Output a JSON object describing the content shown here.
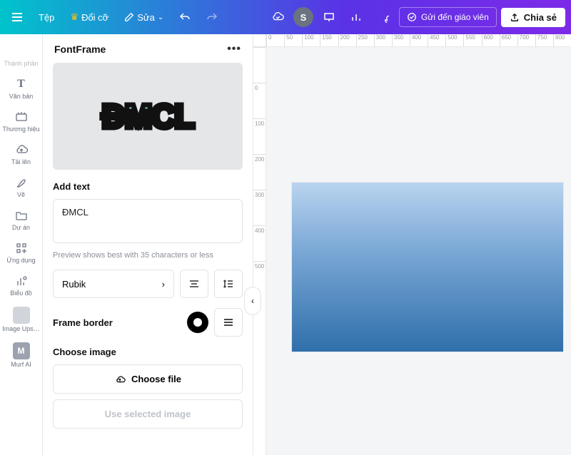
{
  "topbar": {
    "file_label": "Tệp",
    "resize_label": "Đổi cỡ",
    "edit_label": "Sửa",
    "avatar_initial": "S",
    "send_teacher_label": "Gửi đến giáo viên",
    "share_label": "Chia sẻ"
  },
  "leftnav": {
    "items": [
      {
        "label": "Thành phần",
        "icon": ""
      },
      {
        "label": "Văn bản",
        "icon": "T"
      },
      {
        "label": "Thương hiệu",
        "icon": "⎘"
      },
      {
        "label": "Tải lên",
        "icon": "☁"
      },
      {
        "label": "Vẽ",
        "icon": "✎"
      },
      {
        "label": "Dự án",
        "icon": "▭"
      },
      {
        "label": "Ứng dụng",
        "icon": "⊞"
      },
      {
        "label": "Biểu đồ",
        "icon": "⫞"
      },
      {
        "label": "Image Ups…",
        "icon": ""
      },
      {
        "label": "Murf AI",
        "icon": "M"
      }
    ]
  },
  "panel": {
    "title": "FontFrame",
    "preview_text": "ĐMCL",
    "add_text_label": "Add text",
    "text_value": "ĐMCL",
    "hint": "Preview shows best with 35 characters or less",
    "font_name": "Rubik",
    "frame_border_label": "Frame border",
    "choose_image_label": "Choose image",
    "choose_file_label": "Choose file",
    "use_selected_label": "Use selected image"
  },
  "ruler": {
    "h_ticks": [
      "0",
      "50",
      "100",
      "150",
      "200",
      "250",
      "300",
      "350",
      "400",
      "450",
      "500",
      "550",
      "600",
      "650",
      "700",
      "750",
      "800"
    ],
    "v_ticks": [
      "",
      "0",
      "100",
      "200",
      "300",
      "400",
      "500"
    ]
  }
}
